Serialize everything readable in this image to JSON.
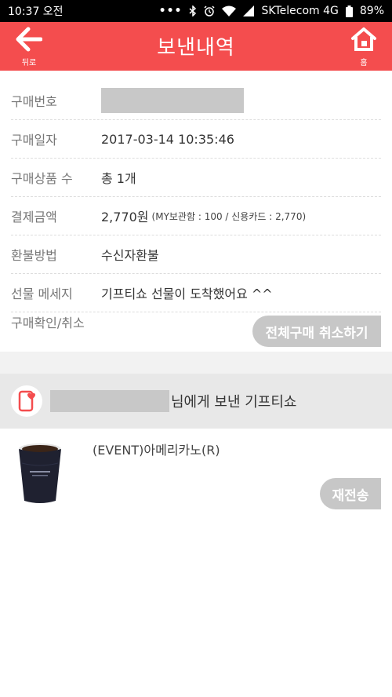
{
  "status_bar": {
    "time": "10:37 오전",
    "carrier": "SKTelecom 4G",
    "battery": "89%",
    "icons": [
      "more-dots-icon",
      "bluetooth-icon",
      "alarm-icon",
      "wifi-icon",
      "signal-icon",
      "battery-icon"
    ]
  },
  "header": {
    "title": "보낸내역",
    "back_label": "뒤로",
    "home_label": "홈",
    "background": "#f44d4e"
  },
  "info": {
    "order_number": {
      "label": "구매번호"
    },
    "purchase_date": {
      "label": "구매일자",
      "value": "2017-03-14 10:35:46"
    },
    "item_count": {
      "label": "구매상품 수",
      "value": "총 1개"
    },
    "payment": {
      "label": "결제금액",
      "value": "2,770원",
      "detail": "(MY보관함 : 100 / 신용카드 : 2,770)"
    },
    "refund_method": {
      "label": "환불방법",
      "value": "수신자환불"
    },
    "gift_message": {
      "label": "선물 메세지",
      "value": "기프티쇼 선물이 도착했어요 ^^"
    },
    "confirm_cancel": {
      "label": "구매확인/취소",
      "button": "전체구매 취소하기"
    }
  },
  "recipient": {
    "suffix": "님에게 보낸 기프티쇼"
  },
  "gift": {
    "name": "(EVENT)아메리카노(R)",
    "resend_button": "재전송",
    "thumbnail_icon": "coffee-cup-icon"
  }
}
